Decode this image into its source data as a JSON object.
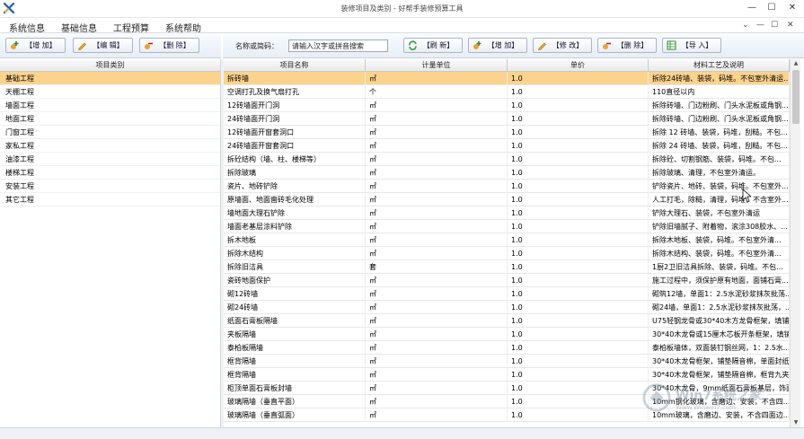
{
  "window": {
    "title": "装修项目及类别 - 好帮手装修预算工具",
    "minimize": "—",
    "maximize": "☐",
    "close": "✕"
  },
  "menu": {
    "items": [
      "系统信息",
      "基础信息",
      "工程预算",
      "系统帮助"
    ],
    "right_controls": [
      "⌄",
      "—",
      "☐",
      "✕"
    ]
  },
  "left_toolbar": {
    "add": "【增 加】",
    "edit": "【编 辑】",
    "delete": "【删 除】"
  },
  "right_toolbar": {
    "search_label": "名称或简码：",
    "search_placeholder": "请输入汉字或拼音搜索",
    "refresh": "【刷 新】",
    "add": "【增 加】",
    "modify": "【修 改】",
    "delete": "【删 除】",
    "import": "【导 入】"
  },
  "categories": {
    "header": "项目类别",
    "items": [
      "基础工程",
      "天棚工程",
      "墙面工程",
      "地面工程",
      "门窗工程",
      "家私工程",
      "油漆工程",
      "楼梯工程",
      "安装工程",
      "其它工程"
    ],
    "selected_index": 0
  },
  "grid": {
    "columns": [
      "项目名称",
      "计量单位",
      "单价",
      "材料工艺及说明"
    ],
    "selected_index": 0,
    "rows": [
      [
        "拆砖墙",
        "㎡",
        "1.0",
        "拆除24砖墙、装袋，码堆。不包室外清运..."
      ],
      [
        "空调打孔及换气扇打孔",
        "个",
        "1.0",
        "110直径以内"
      ],
      [
        "12砖墙面开门洞",
        "㎡",
        "1.0",
        "拆除砖墙、门边粉刷、门头水泥板或角钢..."
      ],
      [
        "24砖墙面开门洞",
        "㎡",
        "1.0",
        "拆除砖墙、门边粉刷、门头水泥板或角钢..."
      ],
      [
        "12砖墙面开窗套洞口",
        "㎡",
        "1.0",
        "拆除 12 砖墙、装袋，码堆，刮糙。不包..."
      ],
      [
        "24砖墙面开窗套洞口",
        "㎡",
        "1.0",
        "拆除 24 砖墙、装袋，码堆，刮糙。不包..."
      ],
      [
        "拆砼结构（墙、柱、楼梯等）",
        "㎡",
        "1.0",
        "拆除砼、切割钢筋、装袋，码堆。不包..."
      ],
      [
        "拆除玻璃",
        "㎡",
        "1.0",
        "拆除玻璃、清理，不包室外清运。"
      ],
      [
        "瓷片、地砖铲除",
        "㎡",
        "1.0",
        "铲除瓷片、地砖、装袋，码堆。不包室外..."
      ],
      [
        "原墙面、地面凿砖毛化处理",
        "㎡",
        "1.0",
        "人工打毛，除糙，清理，码堆，不含室外..."
      ],
      [
        "墙地面大理石铲除",
        "㎡",
        "1.0",
        "铲除大理石、装袋，不包室外清运"
      ],
      [
        "墙面老基层涂料铲除",
        "㎡",
        "1.0",
        "铲除旧墙腻子、附着物，滚涂308胶水、..."
      ],
      [
        "拆木地板",
        "㎡",
        "1.0",
        "拆除木地板、装袋，码堆。不包室外清..."
      ],
      [
        "拆除木结构",
        "㎡",
        "1.0",
        "拆除木结构、装袋，码堆。不包室外清..."
      ],
      [
        "拆除旧洁具",
        "套",
        "1.0",
        "1厨2卫旧洁具拆除、装袋，码堆。不包..."
      ],
      [
        "瓷砖地面保护",
        "㎡",
        "1.0",
        "施工过程中，须保护原有地面，面铺石膏..."
      ],
      [
        "砌12砖墙",
        "㎡",
        "1.0",
        "砌筑12墙，单面1：2.5水泥砂浆抹灰批荡..."
      ],
      [
        "砌24砖墙",
        "㎡",
        "1.0",
        "砌24墙，单面1：2.5水泥砂浆抹灰批荡，..."
      ],
      [
        "纸面石膏板隔墙",
        "㎡",
        "1.0",
        "U75轻钢龙骨或30*40木方龙骨框架，填铺..."
      ],
      [
        "夹板隔墙",
        "㎡",
        "1.0",
        "30*40木龙骨或15厘木芯板开条框架，填铺..."
      ],
      [
        "泰柏板隔墙",
        "㎡",
        "1.0",
        "泰柏板墙体，双面装钉钢丝网，1：2.5水..."
      ],
      [
        "框背隔墙",
        "㎡",
        "1.0",
        "30*40木龙骨框架，铺垫隔音棉，单面封纸..."
      ],
      [
        "框背隔墙",
        "㎡",
        "1.0",
        "30*40木龙骨框架，铺垫隔音棉，框背九夹..."
      ],
      [
        "柜顶单面石膏板封墙",
        "㎡",
        "1.0",
        "30*40木龙骨，9mm纸面石膏板基层，饰面..."
      ],
      [
        "玻璃隔墙（垂直平面）",
        "㎡",
        "1.0",
        "10mm钢化玻璃，含磨边、安装，不含四..."
      ],
      [
        "玻璃隔墙（垂直弧面）",
        "㎡",
        "1.0",
        "10mm玻璃，含磨边、安装，不含四面边..."
      ]
    ]
  },
  "watermark": {
    "text": "Win7系统之家",
    "sub": "Www.Winwin7.com"
  },
  "colors": {
    "selection": "#fbd38c",
    "toolbar_bg": "#e8eef6"
  }
}
